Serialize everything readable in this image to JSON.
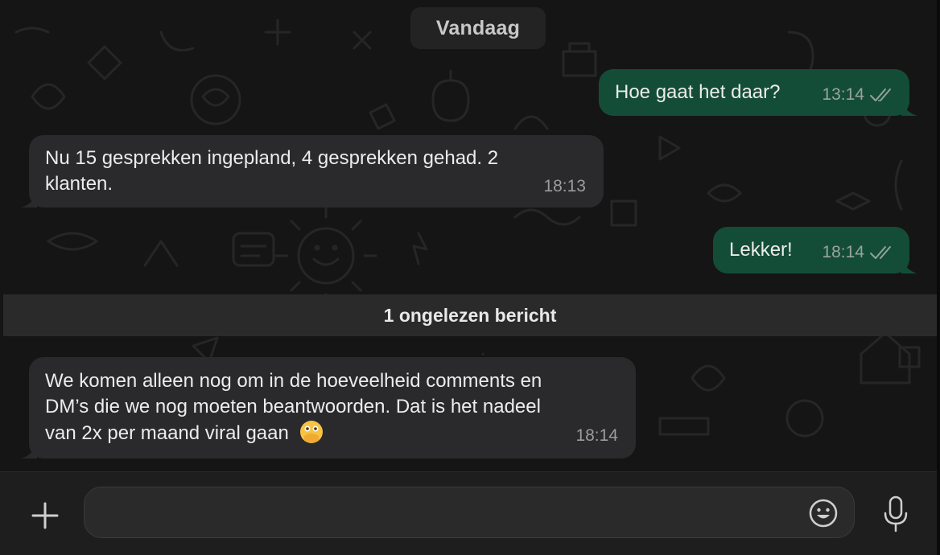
{
  "chat": {
    "date_separator": "Vandaag",
    "unread_banner": "1 ongelezen bericht",
    "messages": [
      {
        "direction": "outgoing",
        "text": "Hoe gaat het daar?",
        "time": "13:14",
        "status": "read"
      },
      {
        "direction": "incoming",
        "text_line1": "Nu 15 gesprekken ingepland, 4 gesprekken gehad. 2",
        "text_line2": "klanten.",
        "time": "18:13"
      },
      {
        "direction": "outgoing",
        "text": "Lekker!",
        "time": "18:14",
        "status": "read"
      },
      {
        "direction": "incoming",
        "text_line1": "We komen alleen nog om in de hoeveelheid comments en",
        "text_line2": "DM’s die we nog moeten beantwoorden. Dat is het nadeel",
        "text_line3": "van 2x per maand viral gaan",
        "emoji": "🫣",
        "time": "18:14"
      }
    ]
  },
  "composer": {
    "value": "",
    "placeholder": "",
    "icons": {
      "attach": "plus-icon",
      "emoji": "smiley-icon",
      "voice": "microphone-icon"
    }
  },
  "colors": {
    "outgoing_bubble": "#144d37",
    "incoming_bubble": "#2a2a2c",
    "background": "#151515",
    "read_ticks": "#9aa39f"
  }
}
